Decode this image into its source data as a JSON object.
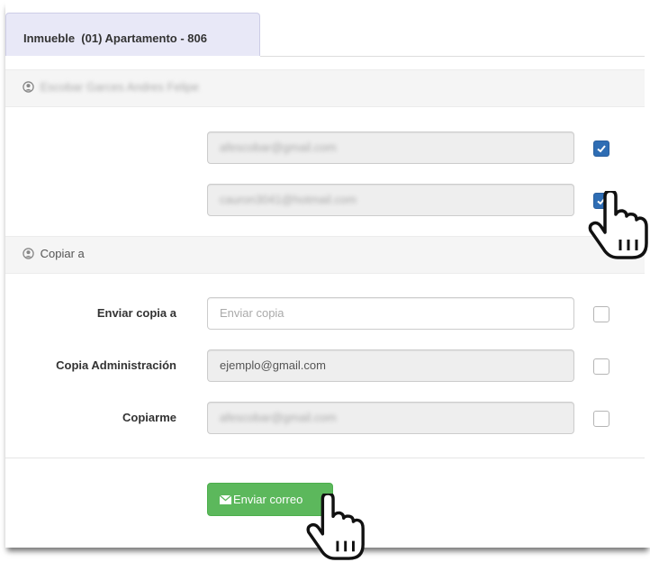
{
  "tab": {
    "label": "Inmueble  (01) Apartamento - 806"
  },
  "recipient": {
    "name": "Escobar Garces Andres Felipe"
  },
  "emails": [
    {
      "value": "afescobar@gmail.com",
      "checked": true
    },
    {
      "value": "cauron3041@hotmail.com",
      "checked": true
    }
  ],
  "copy_section": {
    "title": "Copiar a"
  },
  "copy_rows": [
    {
      "label": "Enviar copia a",
      "placeholder": "Enviar copia",
      "value": ""
    },
    {
      "label": "Copia Administración",
      "value": "ejemplo@gmail.com"
    },
    {
      "label": "Copiarme",
      "value": "afescobar@gmail.com"
    }
  ],
  "send_button": {
    "label": "Enviar correo",
    "icon": "envelope-icon",
    "color": "#5cb85c"
  },
  "colors": {
    "checkbox_checked": "#2e6db4",
    "tab_bg": "#e8e8f7"
  }
}
